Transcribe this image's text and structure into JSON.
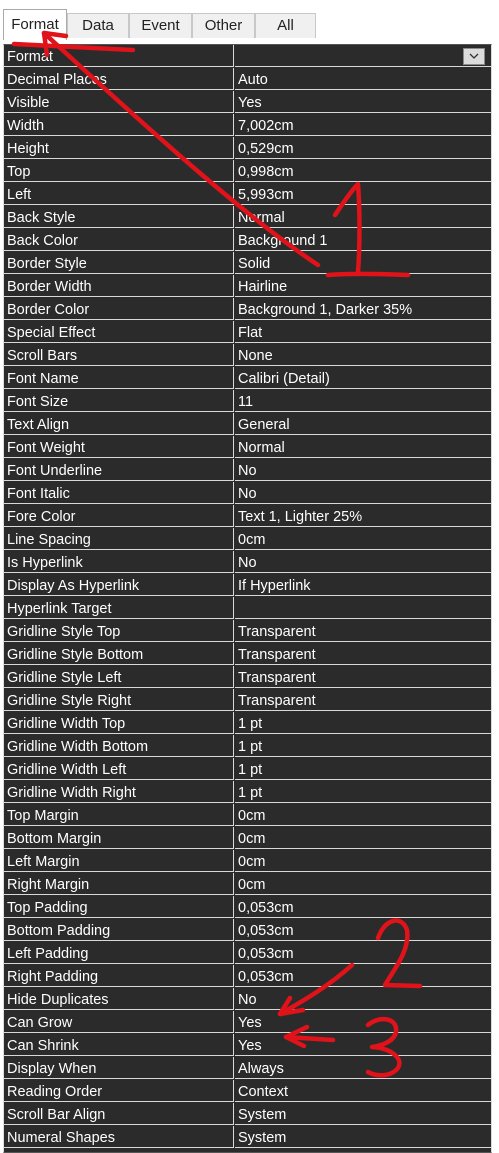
{
  "tabs": [
    "Format",
    "Data",
    "Event",
    "Other",
    "All"
  ],
  "properties": [
    {
      "name": "Format",
      "value": ""
    },
    {
      "name": "Decimal Places",
      "value": "Auto"
    },
    {
      "name": "Visible",
      "value": "Yes"
    },
    {
      "name": "Width",
      "value": "7,002cm"
    },
    {
      "name": "Height",
      "value": "0,529cm"
    },
    {
      "name": "Top",
      "value": "0,998cm"
    },
    {
      "name": "Left",
      "value": "5,993cm"
    },
    {
      "name": "Back Style",
      "value": "Normal"
    },
    {
      "name": "Back Color",
      "value": "Background 1"
    },
    {
      "name": "Border Style",
      "value": "Solid"
    },
    {
      "name": "Border Width",
      "value": "Hairline"
    },
    {
      "name": "Border Color",
      "value": "Background 1, Darker 35%"
    },
    {
      "name": "Special Effect",
      "value": "Flat"
    },
    {
      "name": "Scroll Bars",
      "value": "None"
    },
    {
      "name": "Font Name",
      "value": "Calibri (Detail)"
    },
    {
      "name": "Font Size",
      "value": "11"
    },
    {
      "name": "Text Align",
      "value": "General"
    },
    {
      "name": "Font Weight",
      "value": "Normal"
    },
    {
      "name": "Font Underline",
      "value": "No"
    },
    {
      "name": "Font Italic",
      "value": "No"
    },
    {
      "name": "Fore Color",
      "value": "Text 1, Lighter 25%"
    },
    {
      "name": "Line Spacing",
      "value": "0cm"
    },
    {
      "name": "Is Hyperlink",
      "value": "No"
    },
    {
      "name": "Display As Hyperlink",
      "value": "If Hyperlink"
    },
    {
      "name": "Hyperlink Target",
      "value": ""
    },
    {
      "name": "Gridline Style Top",
      "value": "Transparent"
    },
    {
      "name": "Gridline Style Bottom",
      "value": "Transparent"
    },
    {
      "name": "Gridline Style Left",
      "value": "Transparent"
    },
    {
      "name": "Gridline Style Right",
      "value": "Transparent"
    },
    {
      "name": "Gridline Width Top",
      "value": "1 pt"
    },
    {
      "name": "Gridline Width Bottom",
      "value": "1 pt"
    },
    {
      "name": "Gridline Width Left",
      "value": "1 pt"
    },
    {
      "name": "Gridline Width Right",
      "value": "1 pt"
    },
    {
      "name": "Top Margin",
      "value": "0cm"
    },
    {
      "name": "Bottom Margin",
      "value": "0cm"
    },
    {
      "name": "Left Margin",
      "value": "0cm"
    },
    {
      "name": "Right Margin",
      "value": "0cm"
    },
    {
      "name": "Top Padding",
      "value": "0,053cm"
    },
    {
      "name": "Bottom Padding",
      "value": "0,053cm"
    },
    {
      "name": "Left Padding",
      "value": "0,053cm"
    },
    {
      "name": "Right Padding",
      "value": "0,053cm"
    },
    {
      "name": "Hide Duplicates",
      "value": "No"
    },
    {
      "name": "Can Grow",
      "value": "Yes"
    },
    {
      "name": "Can Shrink",
      "value": "Yes"
    },
    {
      "name": "Display When",
      "value": "Always"
    },
    {
      "name": "Reading Order",
      "value": "Context"
    },
    {
      "name": "Scroll Bar Align",
      "value": "System"
    },
    {
      "name": "Numeral Shapes",
      "value": "System"
    }
  ],
  "annotations": {
    "numbers": [
      "1",
      "2",
      "3"
    ],
    "ink_color": "#e0121a"
  },
  "colors": {
    "grid_bg": "#2b2b2b",
    "grid_line": "#d9d9d9",
    "text": "#ffffff"
  }
}
